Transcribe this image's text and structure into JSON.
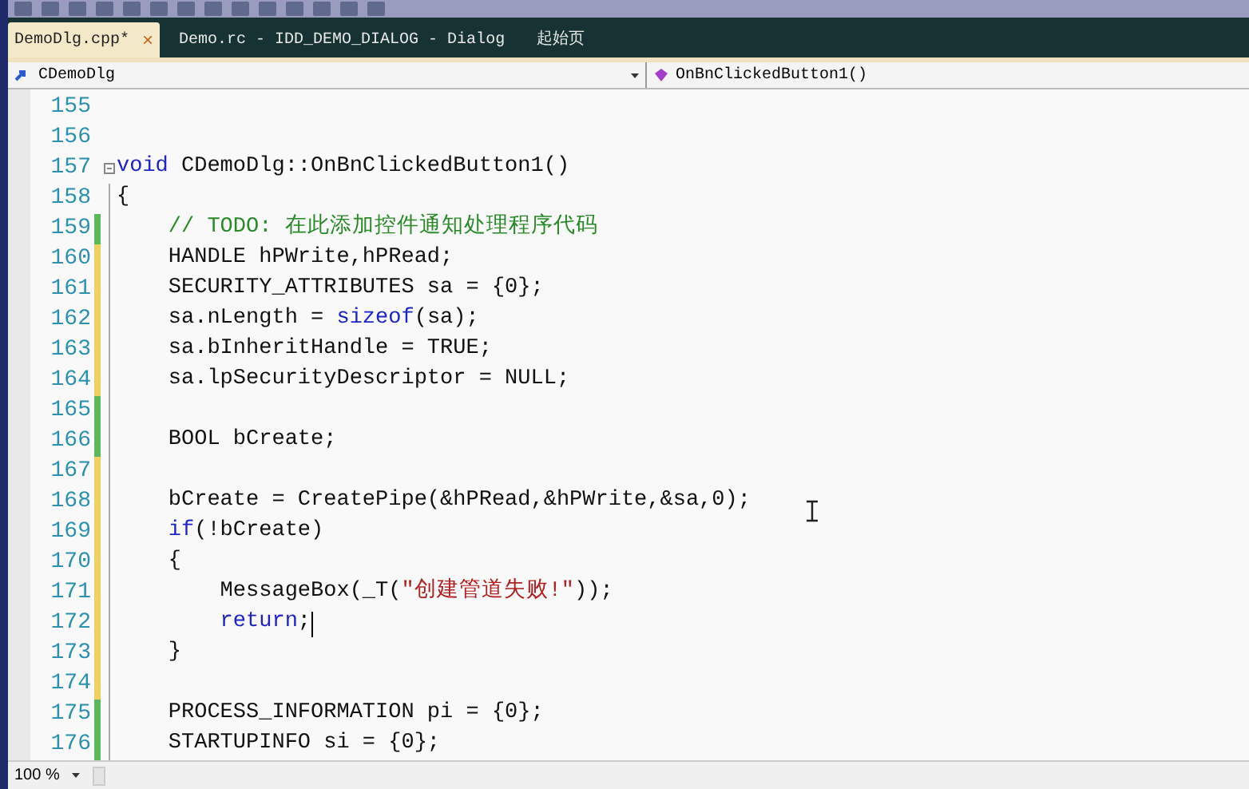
{
  "tabs": [
    {
      "label": "DemoDlg.cpp*",
      "selected": true,
      "close": "×"
    },
    {
      "label": "Demo.rc - IDD_DEMO_DIALOG - Dialog",
      "selected": false
    },
    {
      "label": "起始页",
      "selected": false
    }
  ],
  "navigation": {
    "class_dropdown": "CDemoDlg",
    "member_dropdown": "OnBnClickedButton1()"
  },
  "lines": [
    {
      "number": "155"
    },
    {
      "number": "156"
    },
    {
      "number": "157",
      "collapsible": true,
      "tokens": [
        {
          "kind": "keyword",
          "text": "void"
        },
        {
          "kind": "plain",
          "text": " CDemoDlg::OnBnClickedButton1()"
        }
      ]
    },
    {
      "number": "158",
      "tokens": [
        {
          "kind": "plain",
          "text": "{"
        }
      ]
    },
    {
      "number": "159",
      "color": "#5cb85c",
      "tokens": [
        {
          "kind": "comment",
          "text": "    // TODO: 在此添加控件通知处理程序代码"
        }
      ]
    },
    {
      "number": "160",
      "color": "#f0d060",
      "tokens": [
        {
          "kind": "plain",
          "text": "    HANDLE hPWrite,hPRead;"
        }
      ]
    },
    {
      "number": "161",
      "color": "#f0d060",
      "tokens": [
        {
          "kind": "plain",
          "text": "    SECURITY_ATTRIBUTES sa = {0};"
        }
      ]
    },
    {
      "number": "162",
      "color": "#f0d060",
      "tokens": [
        {
          "kind": "plain",
          "text": "    sa.nLength = "
        },
        {
          "kind": "keyword",
          "text": "sizeof"
        },
        {
          "kind": "plain",
          "text": "(sa);"
        }
      ]
    },
    {
      "number": "163",
      "color": "#f0d060",
      "tokens": [
        {
          "kind": "plain",
          "text": "    sa.bInheritHandle = TRUE;"
        }
      ]
    },
    {
      "number": "164",
      "color": "#f0d060",
      "tokens": [
        {
          "kind": "plain",
          "text": "    sa.lpSecurityDescriptor = NULL;"
        }
      ]
    },
    {
      "number": "165",
      "color": "#5cb85c"
    },
    {
      "number": "166",
      "color": "#5cb85c",
      "tokens": [
        {
          "kind": "plain",
          "text": "    BOOL bCreate;"
        }
      ]
    },
    {
      "number": "167",
      "color": "#f0d060"
    },
    {
      "number": "168",
      "color": "#f0d060",
      "tokens": [
        {
          "kind": "plain",
          "text": "    bCreate = CreatePipe(&hPRead,&hPWrite,&sa,0);"
        }
      ]
    },
    {
      "number": "169",
      "color": "#f0d060",
      "tokens": [
        {
          "kind": "keyword",
          "text": "    if"
        },
        {
          "kind": "plain",
          "text": "(!bCreate)"
        }
      ]
    },
    {
      "number": "170",
      "color": "#f0d060",
      "tokens": [
        {
          "kind": "plain",
          "text": "    {"
        }
      ]
    },
    {
      "number": "171",
      "color": "#f0d060",
      "tokens": [
        {
          "kind": "plain",
          "text": "        MessageBox(_T("
        },
        {
          "kind": "string",
          "text": "\"创建管道失败!\""
        },
        {
          "kind": "plain",
          "text": "));"
        }
      ]
    },
    {
      "number": "172",
      "color": "#f0d060",
      "caret": true,
      "tokens": [
        {
          "kind": "keyword",
          "text": "        return"
        },
        {
          "kind": "plain",
          "text": ";"
        }
      ]
    },
    {
      "number": "173",
      "color": "#f0d060",
      "tokens": [
        {
          "kind": "plain",
          "text": "    }"
        }
      ]
    },
    {
      "number": "174",
      "color": "#f0d060"
    },
    {
      "number": "175",
      "color": "#5cb85c",
      "tokens": [
        {
          "kind": "plain",
          "text": "    PROCESS_INFORMATION pi = {0};"
        }
      ]
    },
    {
      "number": "176",
      "color": "#5cb85c",
      "tokens": [
        {
          "kind": "plain",
          "text": "    STARTUPINFO si = {0};"
        }
      ]
    }
  ],
  "status_bar": {
    "zoom": "100 %"
  }
}
